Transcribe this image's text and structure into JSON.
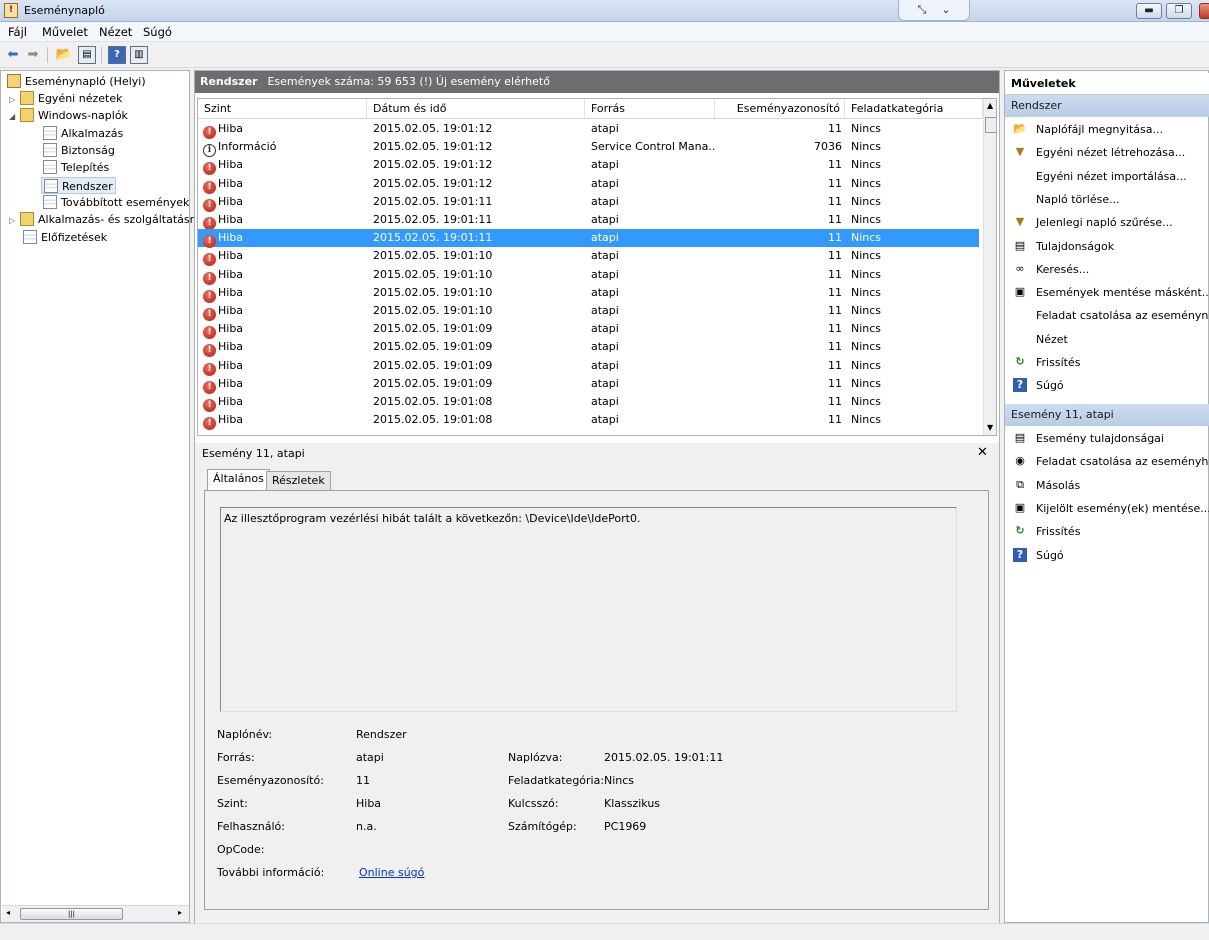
{
  "app": {
    "title": "Eseménynapló"
  },
  "menu": [
    "Fájl",
    "Művelet",
    "Nézet",
    "Súgó"
  ],
  "tree": {
    "root": "Eseménynapló (Helyi)",
    "custom_views": "Egyéni nézetek",
    "windows_logs": "Windows-naplók",
    "logs": [
      "Alkalmazás",
      "Biztonság",
      "Telepítés",
      "Rendszer",
      "Továbbított események"
    ],
    "app_services": "Alkalmazás- és szolgáltatásn",
    "subscriptions": "Előfizetések"
  },
  "panel": {
    "name": "Rendszer",
    "info": "Események száma: 59 653 (!) Új esemény elérhető"
  },
  "grid": {
    "columns": [
      "Szint",
      "Dátum és idő",
      "Forrás",
      "Eseményazonosító",
      "Feladatkategória"
    ],
    "rows": [
      {
        "level": "Hiba",
        "type": "error",
        "date": "2015.02.05. 19:01:12",
        "source": "atapi",
        "id": "11",
        "category": "Nincs"
      },
      {
        "level": "Információ",
        "type": "info",
        "date": "2015.02.05. 19:01:12",
        "source": "Service Control Mana...",
        "id": "7036",
        "category": "Nincs"
      },
      {
        "level": "Hiba",
        "type": "error",
        "date": "2015.02.05. 19:01:12",
        "source": "atapi",
        "id": "11",
        "category": "Nincs"
      },
      {
        "level": "Hiba",
        "type": "error",
        "date": "2015.02.05. 19:01:12",
        "source": "atapi",
        "id": "11",
        "category": "Nincs"
      },
      {
        "level": "Hiba",
        "type": "error",
        "date": "2015.02.05. 19:01:11",
        "source": "atapi",
        "id": "11",
        "category": "Nincs"
      },
      {
        "level": "Hiba",
        "type": "error",
        "date": "2015.02.05. 19:01:11",
        "source": "atapi",
        "id": "11",
        "category": "Nincs"
      },
      {
        "level": "Hiba",
        "type": "error",
        "date": "2015.02.05. 19:01:11",
        "source": "atapi",
        "id": "11",
        "category": "Nincs",
        "selected": true
      },
      {
        "level": "Hiba",
        "type": "error",
        "date": "2015.02.05. 19:01:10",
        "source": "atapi",
        "id": "11",
        "category": "Nincs"
      },
      {
        "level": "Hiba",
        "type": "error",
        "date": "2015.02.05. 19:01:10",
        "source": "atapi",
        "id": "11",
        "category": "Nincs"
      },
      {
        "level": "Hiba",
        "type": "error",
        "date": "2015.02.05. 19:01:10",
        "source": "atapi",
        "id": "11",
        "category": "Nincs"
      },
      {
        "level": "Hiba",
        "type": "error",
        "date": "2015.02.05. 19:01:10",
        "source": "atapi",
        "id": "11",
        "category": "Nincs"
      },
      {
        "level": "Hiba",
        "type": "error",
        "date": "2015.02.05. 19:01:09",
        "source": "atapi",
        "id": "11",
        "category": "Nincs"
      },
      {
        "level": "Hiba",
        "type": "error",
        "date": "2015.02.05. 19:01:09",
        "source": "atapi",
        "id": "11",
        "category": "Nincs"
      },
      {
        "level": "Hiba",
        "type": "error",
        "date": "2015.02.05. 19:01:09",
        "source": "atapi",
        "id": "11",
        "category": "Nincs"
      },
      {
        "level": "Hiba",
        "type": "error",
        "date": "2015.02.05. 19:01:09",
        "source": "atapi",
        "id": "11",
        "category": "Nincs"
      },
      {
        "level": "Hiba",
        "type": "error",
        "date": "2015.02.05. 19:01:08",
        "source": "atapi",
        "id": "11",
        "category": "Nincs"
      },
      {
        "level": "Hiba",
        "type": "error",
        "date": "2015.02.05. 19:01:08",
        "source": "atapi",
        "id": "11",
        "category": "Nincs"
      }
    ]
  },
  "details": {
    "title": "Esemény 11, atapi",
    "tabs": [
      "Általános",
      "Részletek"
    ],
    "description": "Az illesztőprogram vezérlési hibát talált a következőn: \\Device\\Ide\\IdePort0.",
    "fields": {
      "log_name_label": "Naplónév:",
      "log_name": "Rendszer",
      "source_label": "Forrás:",
      "source": "atapi",
      "logged_label": "Naplózva:",
      "logged": "2015.02.05. 19:01:11",
      "event_id_label": "Eseményazonosító:",
      "event_id": "11",
      "task_label": "Feladatkategória:",
      "task": "Nincs",
      "level_label": "Szint:",
      "level": "Hiba",
      "keywords_label": "Kulcsszó:",
      "keywords": "Klasszikus",
      "user_label": "Felhasználó:",
      "user": "n.a.",
      "computer_label": "Számítógép:",
      "computer": "PC1969",
      "opcode_label": "OpCode:",
      "more_info_label": "További információ:",
      "more_info_link": "Online súgó"
    }
  },
  "actions": {
    "title": "Műveletek",
    "section1": "Rendszer",
    "items1": [
      {
        "label": "Naplófájl megnyitása...",
        "icon": "folder-open-icon",
        "glyph": "📂"
      },
      {
        "label": "Egyéni nézet létrehozása...",
        "icon": "filter-icon",
        "glyph": "▼"
      },
      {
        "label": "Egyéni nézet importálása...",
        "icon": "",
        "glyph": ""
      },
      {
        "label": "Napló törlése...",
        "icon": "",
        "glyph": ""
      },
      {
        "label": "Jelenlegi napló szűrése...",
        "icon": "filter-icon",
        "glyph": "▼"
      },
      {
        "label": "Tulajdonságok",
        "icon": "properties-icon",
        "glyph": "▤"
      },
      {
        "label": "Keresés...",
        "icon": "binoculars-icon",
        "glyph": "∞"
      },
      {
        "label": "Események mentése másként...",
        "icon": "save-icon",
        "glyph": "▣"
      },
      {
        "label": "Feladat csatolása az eseménynа...",
        "icon": "",
        "glyph": ""
      },
      {
        "label": "Nézet",
        "icon": "",
        "glyph": ""
      },
      {
        "label": "Frissítés",
        "icon": "refresh-icon",
        "glyph": "↻"
      },
      {
        "label": "Súgó",
        "icon": "help-icon",
        "glyph": "?"
      }
    ],
    "section2": "Esemény 11, atapi",
    "items2": [
      {
        "label": "Esemény tulajdonságai",
        "icon": "properties-icon",
        "glyph": "▤"
      },
      {
        "label": "Feladat csatolása az eseményhe...",
        "icon": "task-icon",
        "glyph": "◉"
      },
      {
        "label": "Másolás",
        "icon": "copy-icon",
        "glyph": "⧉"
      },
      {
        "label": "Kijelölt esemény(ek) mentése...",
        "icon": "save-icon",
        "glyph": "▣"
      },
      {
        "label": "Frissítés",
        "icon": "refresh-icon",
        "glyph": "↻"
      },
      {
        "label": "Súgó",
        "icon": "help-icon",
        "glyph": "?"
      }
    ]
  },
  "colors": {
    "selection": "#3399ff",
    "header_bar": "#6d6d6d",
    "error": "#c0271a",
    "section": "#c6d7ed"
  }
}
